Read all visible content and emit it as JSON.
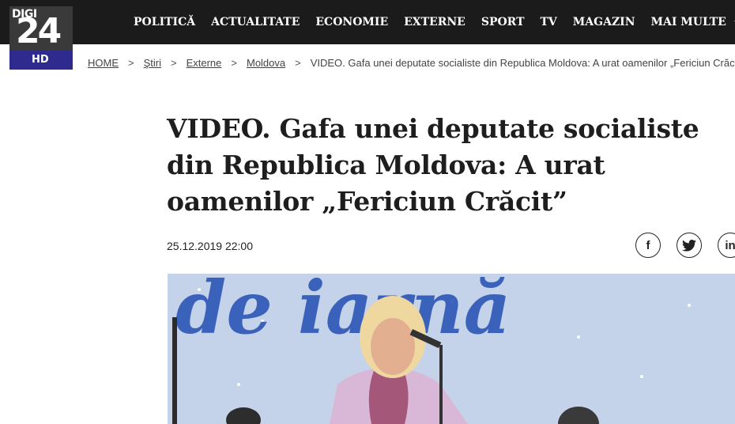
{
  "logo": {
    "brand": "DIGI",
    "number": "24",
    "suffix": "HD"
  },
  "nav": {
    "items": [
      "POLITICĂ",
      "ACTUALITATE",
      "ECONOMIE",
      "EXTERNE",
      "SPORT",
      "TV",
      "MAGAZIN"
    ],
    "more_label": "MAI MULTE"
  },
  "breadcrumb": [
    "HOME",
    "Ştiri",
    "Externe",
    "Moldova",
    "VIDEO. Gafa unei deputate socialiste din Republica Moldova: A urat oamenilor „Fericiun Crăcit”"
  ],
  "breadcrumb_separator": ">",
  "article": {
    "title": "VIDEO. Gafa unei deputate socialiste din Republica Moldova: A urat oamenilor „Fericiun Crăcit”",
    "date": "25.12.2019 22:00"
  },
  "social": {
    "facebook": "f",
    "twitter": "twitter-icon",
    "linkedin": "in"
  },
  "hero": {
    "banner_text": "de iarnă"
  },
  "colors": {
    "topbar": "#1b1b1b",
    "hd_badge": "#2f2a8d",
    "title": "#1e1e1e"
  }
}
